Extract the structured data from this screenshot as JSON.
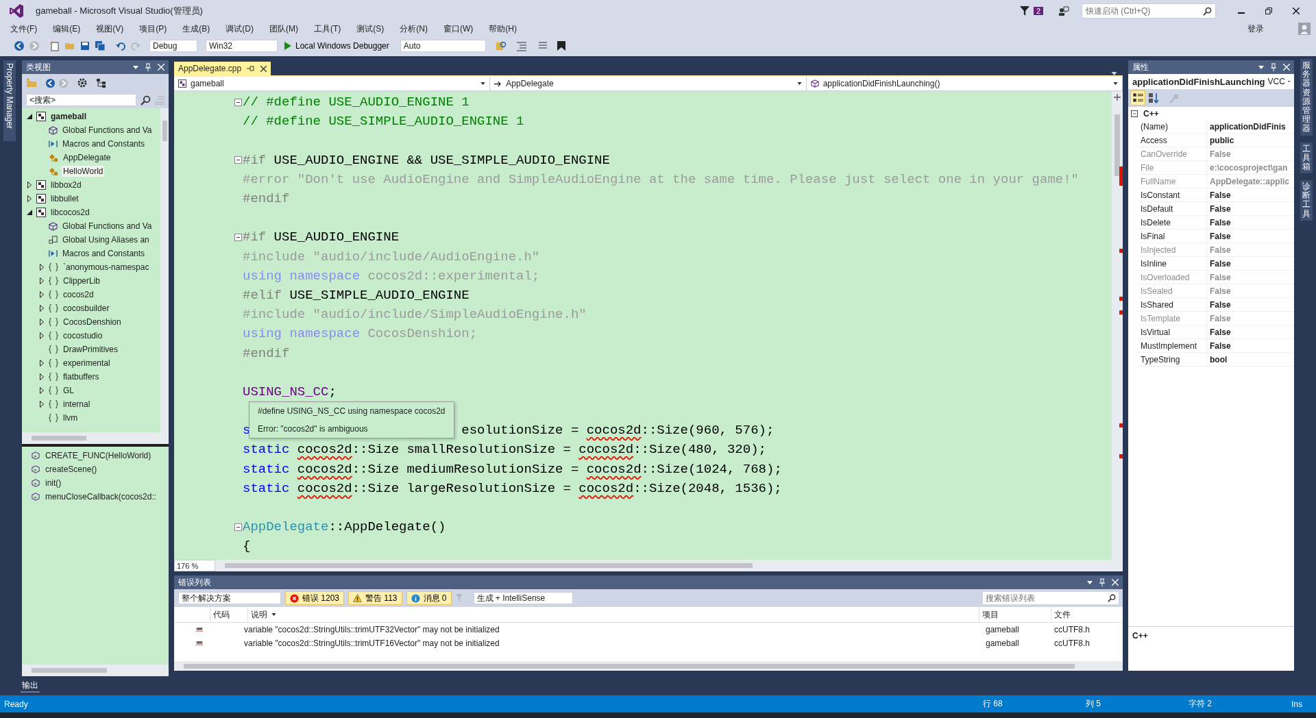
{
  "window": {
    "title": "gameball - Microsoft Visual Studio(管理员)",
    "notification_count": "2",
    "quick_launch": {
      "placeholder": "快速启动 (Ctrl+Q)"
    },
    "sign_in": "登录"
  },
  "menu": [
    "文件(F)",
    "编辑(E)",
    "视图(V)",
    "项目(P)",
    "生成(B)",
    "调试(D)",
    "团队(M)",
    "工具(T)",
    "测试(S)",
    "分析(N)",
    "窗口(W)",
    "帮助(H)"
  ],
  "toolbar": {
    "configuration": "Debug",
    "platform": "Win32",
    "debugger": "Local Windows Debugger",
    "mode": "Auto"
  },
  "left_strip": {
    "label": "Property Manager"
  },
  "class_view": {
    "title": "类视图",
    "search": {
      "placeholder": "<搜索>"
    },
    "tree": [
      {
        "label": "gameball",
        "kind": "project",
        "bold": true,
        "expanded": true,
        "selected": false,
        "children": [
          {
            "label": "Global Functions and Va",
            "kind": "function",
            "selected": false
          },
          {
            "label": "Macros and Constants",
            "kind": "macro",
            "selected": false
          },
          {
            "label": "AppDelegate",
            "kind": "class",
            "selected": false
          },
          {
            "label": "HelloWorld",
            "kind": "class",
            "selected": true
          }
        ]
      },
      {
        "label": "libbox2d",
        "kind": "project",
        "bold": false,
        "expanded": false,
        "selected": false
      },
      {
        "label": "libbullet",
        "kind": "project",
        "bold": false,
        "expanded": false,
        "selected": false
      },
      {
        "label": "libcocos2d",
        "kind": "project",
        "bold": false,
        "expanded": true,
        "selected": false,
        "children": [
          {
            "label": "Global Functions and Va",
            "kind": "function",
            "selected": false
          },
          {
            "label": "Global Using Aliases an",
            "kind": "alias",
            "selected": false
          },
          {
            "label": "Macros and Constants",
            "kind": "macro",
            "selected": false
          },
          {
            "label": "`anonymous-namespac",
            "kind": "namespace",
            "expanded": false,
            "selected": false
          },
          {
            "label": "ClipperLib",
            "kind": "namespace",
            "expanded": false,
            "selected": false
          },
          {
            "label": "cocos2d",
            "kind": "namespace",
            "expanded": false,
            "selected": false
          },
          {
            "label": "cocosbuilder",
            "kind": "namespace",
            "expanded": false,
            "selected": false
          },
          {
            "label": "CocosDenshion",
            "kind": "namespace",
            "expanded": false,
            "selected": false
          },
          {
            "label": "cocostudio",
            "kind": "namespace",
            "expanded": false,
            "selected": false
          },
          {
            "label": "DrawPrimitives",
            "kind": "namespace",
            "selected": false
          },
          {
            "label": "experimental",
            "kind": "namespace",
            "expanded": false,
            "selected": false
          },
          {
            "label": "flatbuffers",
            "kind": "namespace",
            "expanded": false,
            "selected": false
          },
          {
            "label": "GL",
            "kind": "namespace",
            "expanded": false,
            "selected": false
          },
          {
            "label": "internal",
            "kind": "namespace",
            "expanded": false,
            "selected": false
          },
          {
            "label": "llvm",
            "kind": "namespace",
            "selected": false
          }
        ]
      }
    ],
    "members": [
      "CREATE_FUNC(HelloWorld)",
      "createScene()",
      "init()",
      "menuCloseCallback(cocos2d::"
    ]
  },
  "editor": {
    "tabs": [
      {
        "label": "AppDelegate.cpp",
        "selected": true
      }
    ],
    "nav": [
      "gameball",
      "AppDelegate",
      "applicationDidFinishLaunching()"
    ],
    "zoom": "176 %",
    "lines": [
      {
        "fold": true,
        "segments": [
          {
            "text": "// #define USE_AUDIO_ENGINE 1",
            "kind": "comment"
          }
        ]
      },
      {
        "fold": false,
        "segments": [
          {
            "text": "// #define USE_SIMPLE_AUDIO_ENGINE 1",
            "kind": "comment"
          }
        ]
      },
      {
        "fold": false
      },
      {
        "fold": true,
        "segments": [
          {
            "text": "#if",
            "kind": "pre"
          },
          {
            "text": " USE_AUDIO_ENGINE && USE_SIMPLE_AUDIO_ENGINE",
            "kind": "plain"
          }
        ]
      },
      {
        "fold": false,
        "segments": [
          {
            "text": "#error \"Don't use AudioEngine and SimpleAudioEngine at the same time. Please just select one in your game!\"",
            "kind": "inactive"
          }
        ]
      },
      {
        "fold": false,
        "segments": [
          {
            "text": "#endif",
            "kind": "pre"
          }
        ]
      },
      {
        "fold": false
      },
      {
        "fold": true,
        "segments": [
          {
            "text": "#if",
            "kind": "pre"
          },
          {
            "text": " USE_AUDIO_ENGINE",
            "kind": "plain"
          }
        ]
      },
      {
        "fold": false,
        "segments": [
          {
            "text": "#include \"audio/include/AudioEngine.h\"",
            "kind": "inactive"
          }
        ]
      },
      {
        "fold": false,
        "segments": [
          {
            "text": "using namespace",
            "kind": "inactive_kw"
          },
          {
            "text": " cocos2d::experimental;",
            "kind": "inactive"
          }
        ]
      },
      {
        "fold": false,
        "segments": [
          {
            "text": "#elif",
            "kind": "pre"
          },
          {
            "text": " USE_SIMPLE_AUDIO_ENGINE",
            "kind": "plain"
          }
        ]
      },
      {
        "fold": false,
        "segments": [
          {
            "text": "#include \"audio/include/SimpleAudioEngine.h\"",
            "kind": "inactive"
          }
        ]
      },
      {
        "fold": false,
        "segments": [
          {
            "text": "using namespace",
            "kind": "inactive_kw"
          },
          {
            "text": " CocosDenshion;",
            "kind": "inactive"
          }
        ]
      },
      {
        "fold": false,
        "segments": [
          {
            "text": "#endif",
            "kind": "pre"
          }
        ]
      },
      {
        "fold": false
      },
      {
        "fold": false,
        "segments": [
          {
            "text": "USING_NS_CC",
            "kind": "macro"
          },
          {
            "text": ";",
            "kind": "plain"
          }
        ]
      },
      {
        "fold": false
      },
      {
        "fold": false,
        "segments": [
          {
            "text": "s",
            "kind": "kw"
          }
        ],
        "after": [
          {
            "text": "esolutionSize = ",
            "kind": "plain"
          },
          {
            "text": "cocos2d",
            "kind": "err"
          },
          {
            "text": "::Size(960, 576);",
            "kind": "plain"
          }
        ],
        "tooltip": [
          "#define USING_NS_CC using namespace cocos2d",
          "Error: \"cocos2d\" is ambiguous"
        ]
      },
      {
        "fold": false,
        "segments": [
          {
            "text": "static ",
            "kind": "kw"
          },
          {
            "text": "cocos2d",
            "kind": "err"
          },
          {
            "text": "::Size smallResolutionSize = ",
            "kind": "plain"
          },
          {
            "text": "cocos2d",
            "kind": "err"
          },
          {
            "text": "::Size(480, 320);",
            "kind": "plain"
          }
        ]
      },
      {
        "fold": false,
        "segments": [
          {
            "text": "static ",
            "kind": "kw"
          },
          {
            "text": "cocos2d",
            "kind": "err"
          },
          {
            "text": "::Size mediumResolutionSize = ",
            "kind": "plain"
          },
          {
            "text": "cocos2d",
            "kind": "err"
          },
          {
            "text": "::Size(1024, 768);",
            "kind": "plain"
          }
        ]
      },
      {
        "fold": false,
        "segments": [
          {
            "text": "static ",
            "kind": "kw"
          },
          {
            "text": "cocos2d",
            "kind": "err"
          },
          {
            "text": "::Size largeResolutionSize = ",
            "kind": "plain"
          },
          {
            "text": "cocos2d",
            "kind": "err"
          },
          {
            "text": "::Size(2048, 1536);",
            "kind": "plain"
          }
        ]
      },
      {
        "fold": false
      },
      {
        "fold": true,
        "segments": [
          {
            "text": "AppDelegate",
            "kind": "type"
          },
          {
            "text": "::AppDelegate()",
            "kind": "plain"
          }
        ]
      },
      {
        "fold": false,
        "segments": [
          {
            "text": "{",
            "kind": "plain"
          }
        ]
      }
    ]
  },
  "properties": {
    "title": "属性",
    "object_name": "applicationDidFinishLaunching",
    "object_type": "VCC",
    "category": "C++",
    "rows": [
      {
        "name": "(Name)",
        "value": "applicationDidFinis",
        "disabled": false
      },
      {
        "name": "Access",
        "value": "public",
        "disabled": false
      },
      {
        "name": "CanOverride",
        "value": "False",
        "disabled": true
      },
      {
        "name": "File",
        "value": "e:\\cocosproject\\gan",
        "disabled": true
      },
      {
        "name": "FullName",
        "value": "AppDelegate::applic",
        "disabled": true
      },
      {
        "name": "IsConstant",
        "value": "False",
        "disabled": false
      },
      {
        "name": "IsDefault",
        "value": "False",
        "disabled": false
      },
      {
        "name": "IsDelete",
        "value": "False",
        "disabled": false
      },
      {
        "name": "IsFinal",
        "value": "False",
        "disabled": false
      },
      {
        "name": "IsInjected",
        "value": "False",
        "disabled": true
      },
      {
        "name": "IsInline",
        "value": "False",
        "disabled": false
      },
      {
        "name": "IsOverloaded",
        "value": "False",
        "disabled": true
      },
      {
        "name": "IsSealed",
        "value": "False",
        "disabled": true
      },
      {
        "name": "IsShared",
        "value": "False",
        "disabled": false
      },
      {
        "name": "IsTemplate",
        "value": "False",
        "disabled": true
      },
      {
        "name": "IsVirtual",
        "value": "False",
        "disabled": false
      },
      {
        "name": "MustImplement",
        "value": "False",
        "disabled": false
      },
      {
        "name": "TypeString",
        "value": "bool",
        "disabled": false
      }
    ],
    "description": "C++"
  },
  "right_strip": [
    "服务器资源管理器",
    "工具箱",
    "诊断工具"
  ],
  "error_list": {
    "title": "错误列表",
    "scope": "整个解决方案",
    "filters": [
      {
        "kind": "error",
        "label": "错误 1203",
        "selected": true
      },
      {
        "kind": "warning",
        "label": "警告 113",
        "selected": true
      },
      {
        "kind": "info",
        "label": "消息 0",
        "selected": true
      }
    ],
    "source": "生成 + IntelliSense",
    "search": {
      "placeholder": "搜索错误列表"
    },
    "columns": [
      "代码",
      "说明",
      "项目",
      "文件"
    ],
    "rows": [
      {
        "description": "variable \"cocos2d::StringUtils::trimUTF32Vector\" may not be initialized",
        "project": "gameball",
        "file": "ccUTF8.h"
      },
      {
        "description": "variable \"cocos2d::StringUtils::trimUTF16Vector\" may not be initialized",
        "project": "gameball",
        "file": "ccUTF8.h"
      }
    ]
  },
  "output_tab": "输出",
  "status_bar": {
    "state": "Ready",
    "line": "行 68",
    "column": "列 5",
    "char": "字符 2",
    "mode": "Ins"
  }
}
